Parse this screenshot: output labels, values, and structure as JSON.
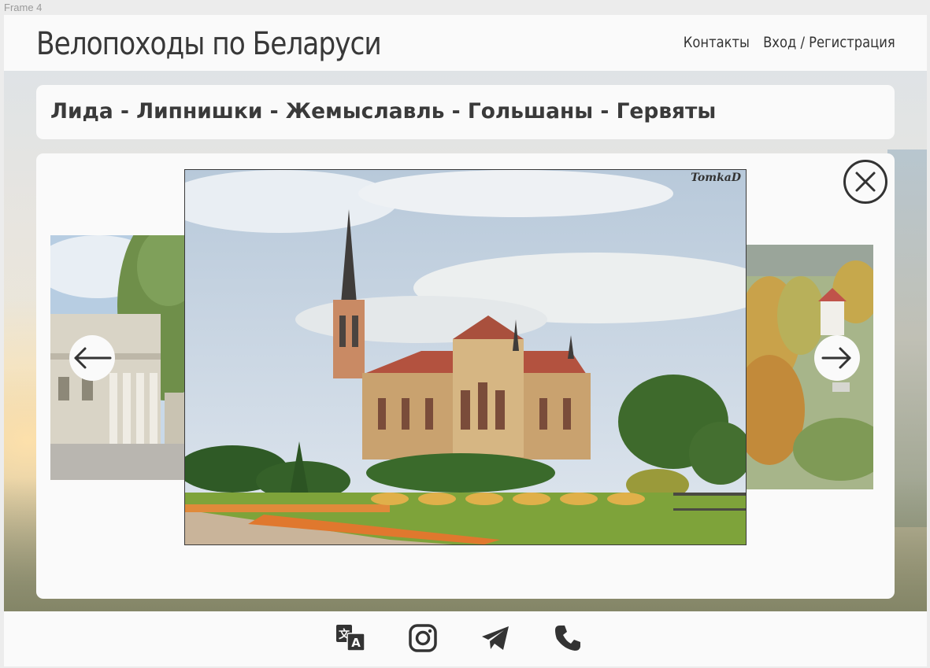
{
  "frame": {
    "label": "Frame 4"
  },
  "header": {
    "title": "Велопоходы по Беларуси",
    "nav": [
      {
        "label": "Контакты"
      },
      {
        "label": "Вход / Регистрация"
      }
    ]
  },
  "route": {
    "title": "Лида - Липнишки - Жемыславль - Гольшаны - Гервяты"
  },
  "gallery": {
    "main_photo": {
      "watermark": "TomkaD",
      "subject": "red-brick-gothic-church"
    },
    "prev_photo": {
      "subject": "manor-with-columns"
    },
    "next_photo": {
      "subject": "aerial-autumn-park"
    },
    "icons": {
      "close": "close-icon",
      "prev": "arrow-left-icon",
      "next": "arrow-right-icon"
    }
  },
  "footer": {
    "icons": [
      "translate-icon",
      "instagram-icon",
      "telegram-icon",
      "phone-icon"
    ]
  },
  "colors": {
    "text": "#333333",
    "panel": "#fafafa",
    "background": "#ececec"
  }
}
